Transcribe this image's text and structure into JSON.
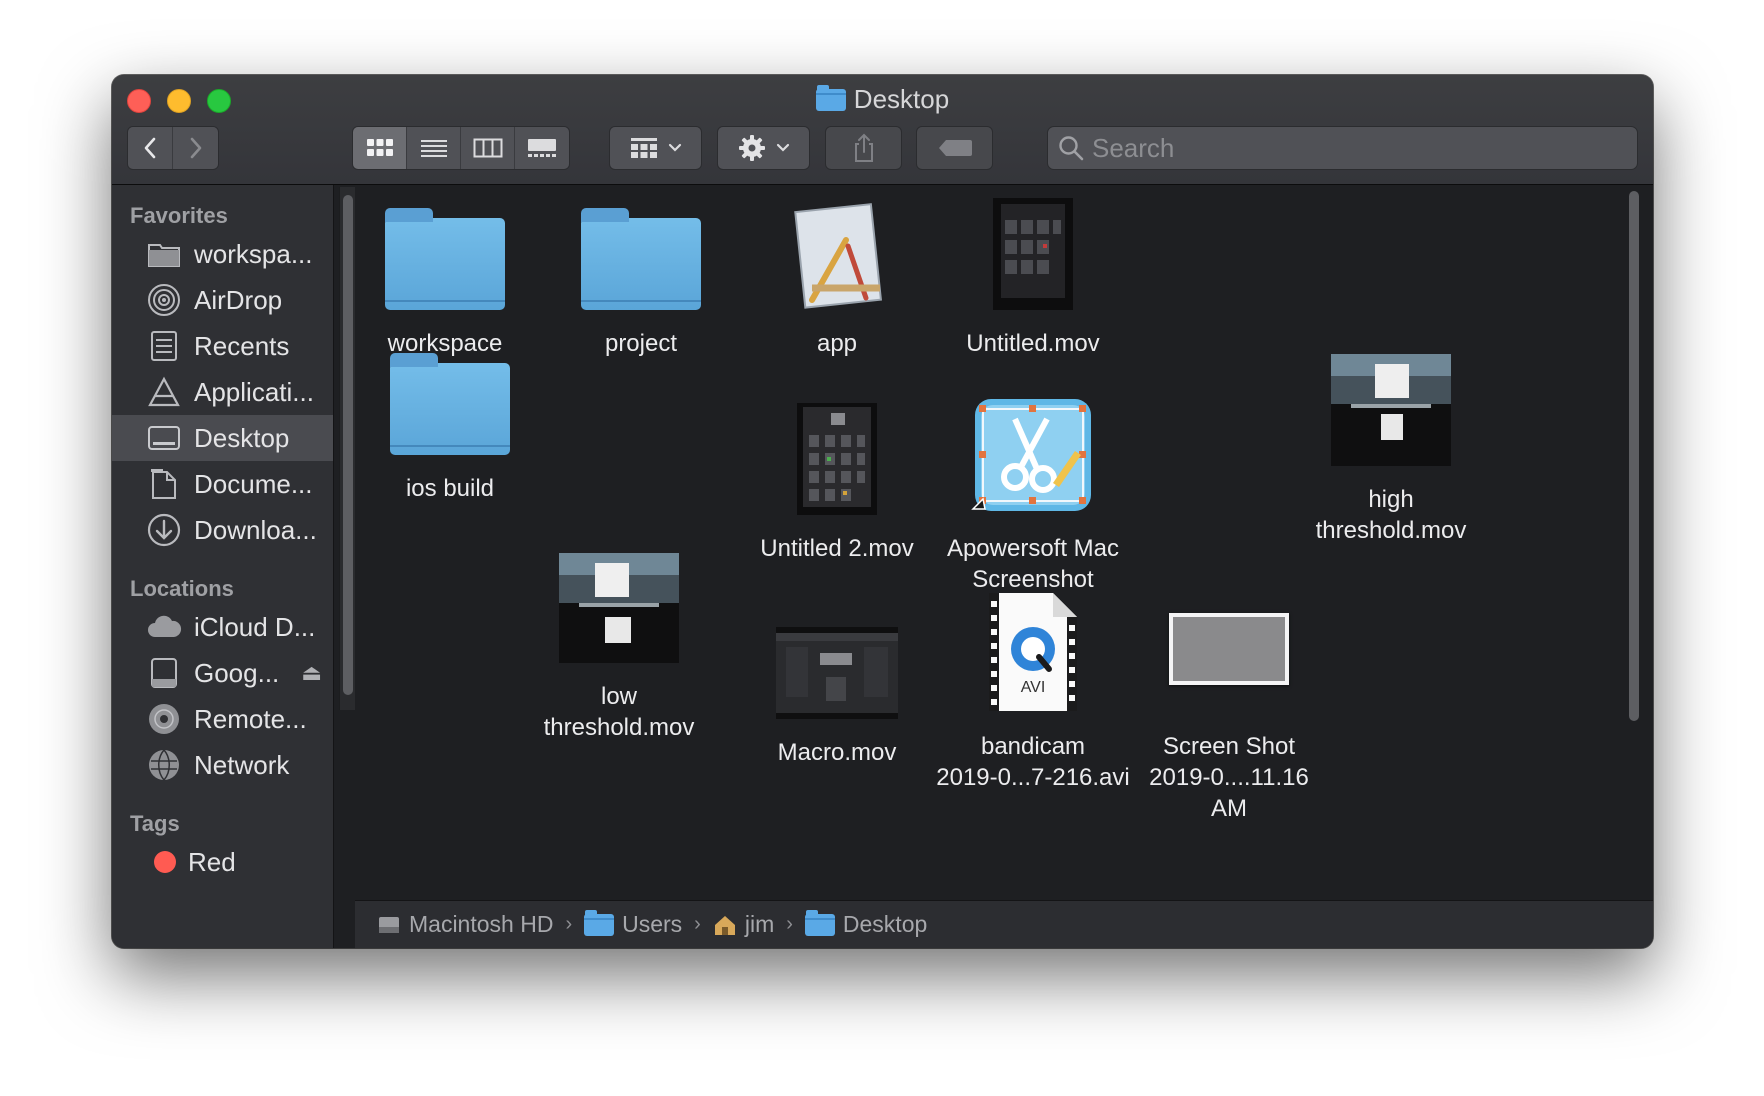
{
  "window": {
    "title": "Desktop"
  },
  "toolbar": {
    "view_modes": [
      "icons",
      "list",
      "columns",
      "gallery"
    ],
    "active_view": "icons"
  },
  "search": {
    "placeholder": "Search",
    "value": ""
  },
  "sidebar": {
    "favorites_heading": "Favorites",
    "favorites": [
      {
        "label": "workspa...",
        "icon": "folder-icon"
      },
      {
        "label": "AirDrop",
        "icon": "airdrop-icon"
      },
      {
        "label": "Recents",
        "icon": "recents-icon"
      },
      {
        "label": "Applicati...",
        "icon": "applications-icon"
      },
      {
        "label": "Desktop",
        "icon": "desktop-icon",
        "active": true
      },
      {
        "label": "Docume...",
        "icon": "documents-icon"
      },
      {
        "label": "Downloa...",
        "icon": "downloads-icon"
      }
    ],
    "locations_heading": "Locations",
    "locations": [
      {
        "label": "iCloud D...",
        "icon": "cloud-icon"
      },
      {
        "label": "Goog...",
        "icon": "drive-icon",
        "eject": true
      },
      {
        "label": "Remote...",
        "icon": "disc-icon"
      },
      {
        "label": "Network",
        "icon": "network-icon"
      }
    ],
    "tags_heading": "Tags",
    "tags": [
      {
        "label": "Red",
        "color": "#ff5b52"
      }
    ]
  },
  "files": [
    {
      "label": "workspace",
      "kind": "folder"
    },
    {
      "label": "project",
      "kind": "folder"
    },
    {
      "label": "app",
      "kind": "app"
    },
    {
      "label": "Untitled.mov",
      "kind": "video"
    },
    {
      "label": "ios build",
      "kind": "folder"
    },
    {
      "label": "Untitled 2.mov",
      "kind": "video"
    },
    {
      "label": "Apowersoft Mac\nScreenshot",
      "kind": "alias-app"
    },
    {
      "label": "high\nthreshold.mov",
      "kind": "video"
    },
    {
      "label": "low\nthreshold.mov",
      "kind": "video"
    },
    {
      "label": "Macro.mov",
      "kind": "video"
    },
    {
      "label": "bandicam\n2019-0...7-216.avi",
      "kind": "avi",
      "badge": "AVI"
    },
    {
      "label": "Screen Shot\n2019-0....11.16 AM",
      "kind": "image"
    }
  ],
  "pathbar": [
    "Macintosh HD",
    "Users",
    "jim",
    "Desktop"
  ],
  "colors": {
    "folder": "#6bb4e4",
    "close": "#fe5f57",
    "minimize": "#febc2e",
    "maximize": "#28c840",
    "tag_red": "#ff5b52"
  }
}
